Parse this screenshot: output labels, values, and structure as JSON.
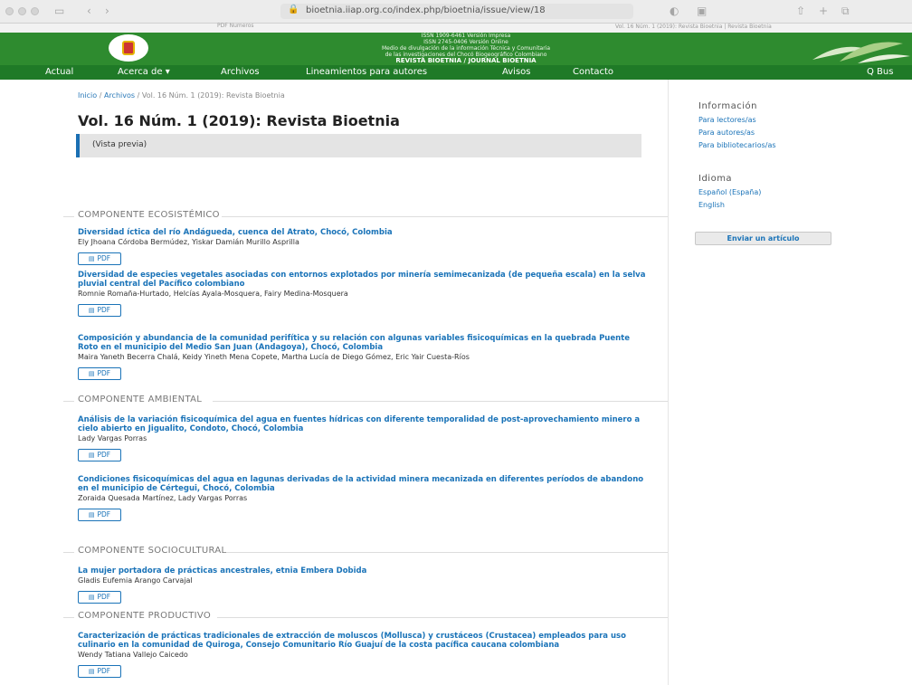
{
  "browser": {
    "url": "bioetnia.iiap.org.co/index.php/bioetnia/issue/view/18",
    "tab_left": "PDF Numeros",
    "tab_right": "Vol. 16 Núm. 1 (2019): Revista Bioetnia | Revista Bioetnia"
  },
  "header": {
    "line1": "ISSN 1909-6461 Versión Impresa",
    "line2": "ISSN 2745-0406 Versión Online",
    "line3": "Medio de divulgación de la información Técnica y Comunitaria",
    "line4": "de las investigaciones del Chocó Biogeográfico Colombiano",
    "title": "REVISTA BIOETNIA / JOURNAL BIOETNIA",
    "brand_color": "#2e8b2f"
  },
  "nav": {
    "items": [
      "Actual",
      "Acerca de ▾",
      "Archivos",
      "Lineamientos para autores",
      "Avisos",
      "Contacto"
    ],
    "search": "Q Bus"
  },
  "breadcrumb": {
    "home": "Inicio",
    "sep": "/",
    "archives": "Archivos",
    "current": "Vol. 16 Núm. 1 (2019): Revista Bioetnia"
  },
  "page_title": "Vol. 16 Núm. 1 (2019): Revista Bioetnia",
  "preview": "(Vista previa)",
  "pdf_label": "PDF",
  "sections": [
    {
      "label": "COMPONENTE ECOSISTÉMICO",
      "articles": [
        {
          "title": "Diversidad íctica del río Andágueda, cuenca del Atrato, Chocó, Colombia",
          "authors": "Ely Jhoana Córdoba Bermúdez, Yiskar Damián Murillo Asprilla"
        },
        {
          "title": "Diversidad de especies vegetales asociadas con entornos explotados por minería semimecanizada (de pequeña escala) en la selva pluvial central del Pacífico colombiano",
          "authors": "Romnie Romaña-Hurtado, Helcías Ayala-Mosquera, Fairy Medina-Mosquera"
        },
        {
          "title": "Composición y abundancia de la comunidad perifítica y su relación con algunas variables fisicoquímicas en la quebrada Puente Roto en el municipio del Medio San Juan (Andagoya), Chocó, Colombia",
          "authors": "Maira Yaneth Becerra Chalá, Keidy Yineth Mena Copete, Martha Lucía de Diego Gómez, Eric Yair Cuesta-Ríos"
        }
      ]
    },
    {
      "label": "COMPONENTE AMBIENTAL",
      "articles": [
        {
          "title": "Análisis de la variación fisicoquímica del agua en fuentes hídricas con diferente temporalidad de post-aprovechamiento minero a cielo abierto en Jigualito, Condoto, Chocó, Colombia",
          "authors": "Lady Vargas Porras"
        },
        {
          "title": "Condiciones fisicoquímicas del agua en lagunas derivadas de la actividad minera mecanizada en diferentes períodos de abandono en el municipio de Cértegui, Chocó, Colombia",
          "authors": "Zoraida Quesada Martínez, Lady Vargas Porras"
        }
      ]
    },
    {
      "label": "COMPONENTE SOCIOCULTURAL",
      "articles": [
        {
          "title": "La mujer portadora de prácticas ancestrales, etnia Embera Dobida",
          "authors": "Gladis Eufemia Arango Carvajal"
        }
      ]
    },
    {
      "label": "COMPONENTE PRODUCTIVO",
      "articles": [
        {
          "title": "Caracterización de prácticas tradicionales de extracción de moluscos (Mollusca) y crustáceos (Crustacea) empleados para uso culinario en la comunidad de Quiroga, Consejo Comunitario Río Guajuí de la costa pacífica caucana colombiana",
          "authors": "Wendy Tatiana Vallejo Caicedo"
        }
      ]
    }
  ],
  "sidebar": {
    "info_title": "Información",
    "info_links": [
      "Para lectores/as",
      "Para autores/as",
      "Para bibliotecarios/as"
    ],
    "lang_title": "Idioma",
    "lang_links": [
      "Español (España)",
      "English"
    ],
    "submit": "Enviar un artículo"
  }
}
